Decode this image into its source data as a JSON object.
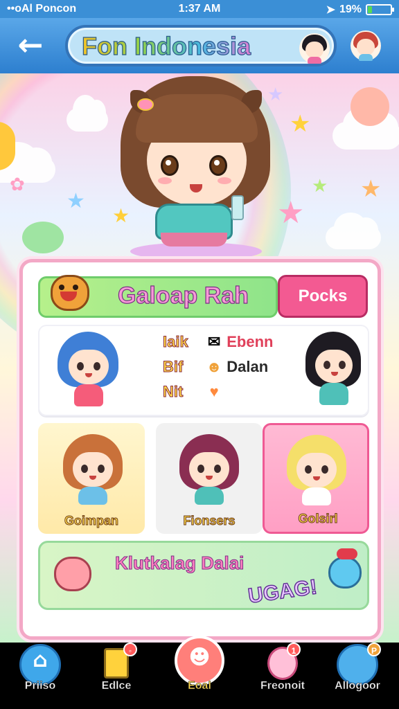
{
  "status": {
    "carrier": "••oAl Poncon",
    "time": "1:37 AM",
    "battery": "19%",
    "battery_level": 0.19
  },
  "header": {
    "title": "Fon Indonesia",
    "back_icon": "back-arrow-icon"
  },
  "panel": {
    "banner_title": "Galoap Rah",
    "packs_button": "Pocks",
    "stats": [
      {
        "label": "Iaik",
        "icon": "envelope-icon",
        "value": "Ebenn"
      },
      {
        "label": "Bif",
        "icon": "smiley-icon",
        "value": "Dalan"
      },
      {
        "label": "Nit",
        "icon": "heart-icon",
        "value": ""
      }
    ],
    "characters": [
      {
        "name": "Goimpan"
      },
      {
        "name": "Fionsers"
      },
      {
        "name": "Golsirl"
      }
    ],
    "promo": {
      "title": "Klutkalag Dalai",
      "tag": "UGAG!"
    }
  },
  "nav": [
    {
      "label": "Priiso",
      "icon": "home-icon",
      "badge": ""
    },
    {
      "label": "Edlce",
      "icon": "note-icon",
      "badge": ""
    },
    {
      "label": "Eoal",
      "icon": "face-icon",
      "badge": ""
    },
    {
      "label": "Freonoit",
      "icon": "character-icon",
      "badge": "1"
    },
    {
      "label": "Allogoor",
      "icon": "bubble-icon",
      "badge": "P"
    }
  ],
  "colors": {
    "header": "#3b8fd6",
    "accent_pink": "#f35a92",
    "banner_green": "#8fe48a"
  }
}
